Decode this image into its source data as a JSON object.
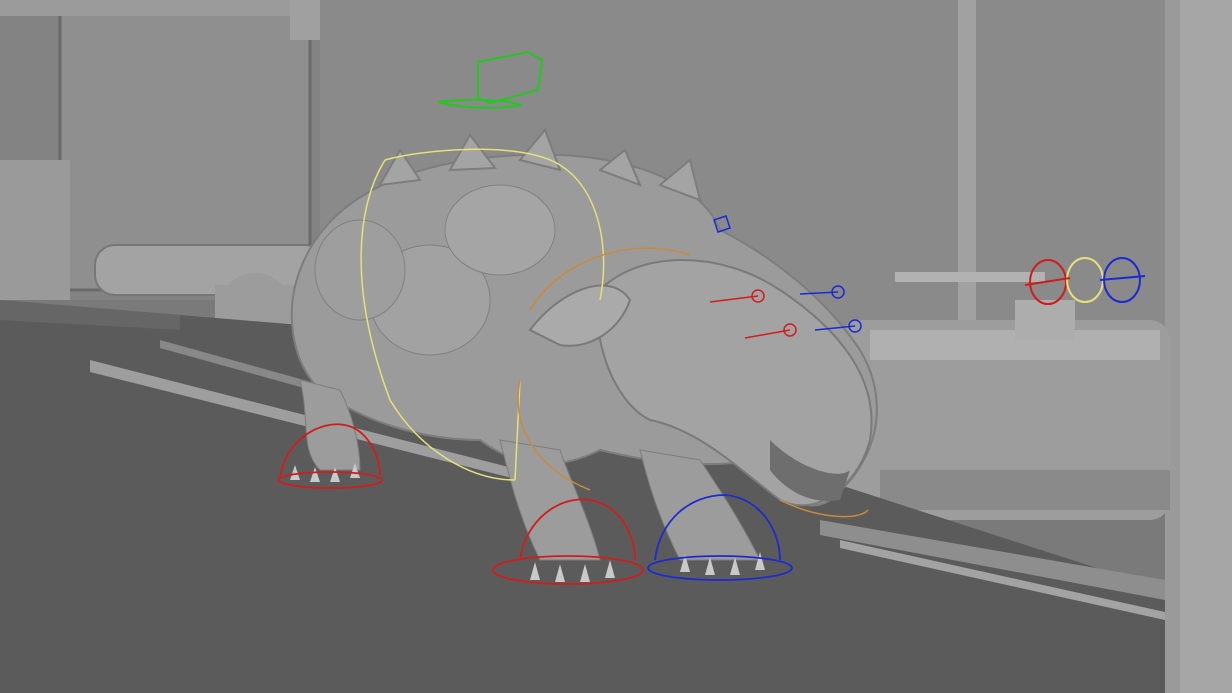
{
  "viewport": {
    "kind": "3d-viewport",
    "shading": "smooth-shaded-grey",
    "subject": "creature-rig"
  },
  "colors": {
    "background": "#6f6f6f",
    "wall": "#8c8c8c",
    "floor": "#5a5a5a",
    "mesh": "#9b9b9b",
    "mesh_shadow": "#7c7c7c",
    "ctrl_red": "#d21c1c",
    "ctrl_blue": "#1c2ad2",
    "ctrl_yellow": "#e6e07a",
    "ctrl_green": "#22c81e",
    "ctrl_orange": "#c98a3c"
  },
  "controls": [
    {
      "name": "world-offset-control",
      "color": "green"
    },
    {
      "name": "cog-body-control",
      "color": "yellow"
    },
    {
      "name": "head-control",
      "color": "orange"
    },
    {
      "name": "eye-aim-left-control",
      "color": "red"
    },
    {
      "name": "eye-aim-right-control",
      "color": "blue"
    },
    {
      "name": "front-left-foot-control",
      "color": "red"
    },
    {
      "name": "front-right-foot-control",
      "color": "blue"
    },
    {
      "name": "back-left-foot-control",
      "color": "red"
    },
    {
      "name": "eye-target-gimbal-control",
      "color": "red-yellow-blue"
    }
  ]
}
